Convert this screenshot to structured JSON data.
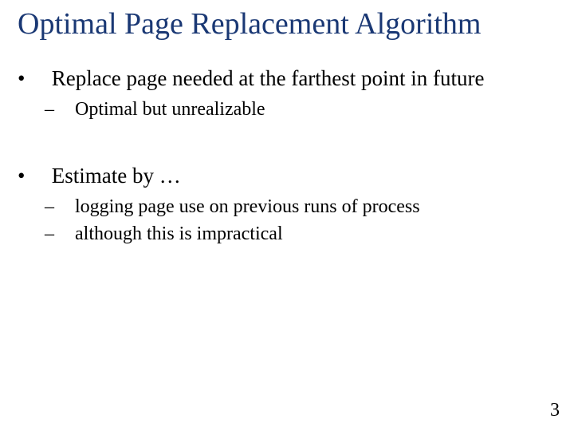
{
  "title": "Optimal Page Replacement Algorithm",
  "bullets": {
    "b1": "Replace page needed at the farthest point in future",
    "b1_1": "Optimal but unrealizable",
    "b2": "Estimate by …",
    "b2_1": "logging page use on previous runs of  process",
    "b2_2": "although this is impractical"
  },
  "page_number": "3",
  "colors": {
    "title": "#1a3874",
    "text": "#000000",
    "background": "#ffffff"
  }
}
